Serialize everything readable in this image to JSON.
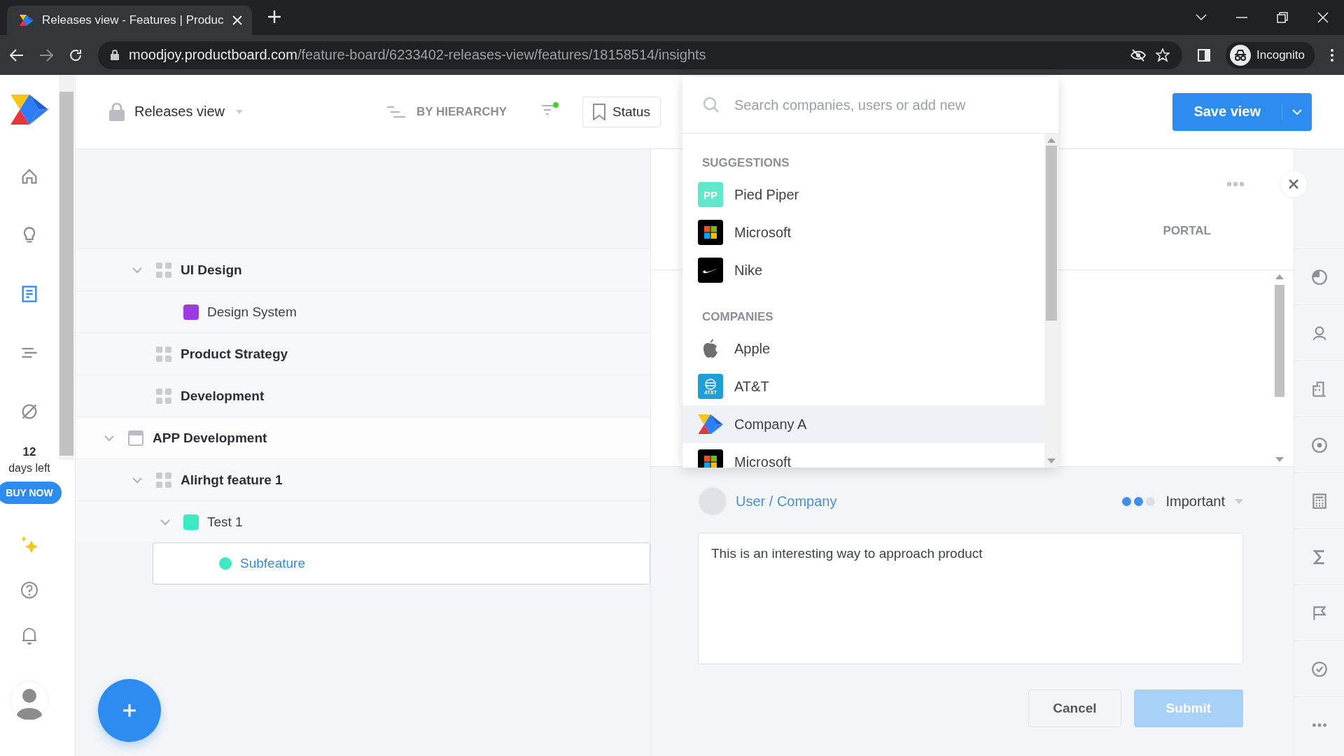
{
  "browser": {
    "tab": {
      "title": "Releases view - Features | Produc"
    },
    "url": {
      "host": "moodjoy.productboard.com",
      "path": "/feature-board/6233402-releases-view/features/18158514/insights"
    },
    "profile": "Incognito"
  },
  "nav": {
    "items": [
      {
        "kind": "home",
        "selected": false
      },
      {
        "kind": "bulb",
        "selected": false
      },
      {
        "kind": "doc",
        "selected": true
      },
      {
        "kind": "lines",
        "selected": false
      },
      {
        "kind": "compass",
        "selected": false
      }
    ],
    "trial": {
      "count": "12",
      "label": "days left",
      "button": "BUY NOW"
    }
  },
  "header": {
    "view_title": "Releases view",
    "grouping": "BY HIERARCHY",
    "filter": {
      "active": true
    },
    "status_button": "Status",
    "save_button": "Save view"
  },
  "tree": {
    "continued": [
      {
        "label": "UI Design",
        "kind": "group",
        "expanded": true,
        "selected": false,
        "children": [
          {
            "label": "Design System",
            "kind": "feature",
            "color": "#9b3be8",
            "selected": false
          }
        ]
      },
      {
        "label": "Product Strategy",
        "kind": "group",
        "selected": false
      },
      {
        "label": "Development",
        "kind": "group",
        "selected": false
      }
    ],
    "items": [
      {
        "label": "APP Development",
        "kind": "release",
        "expanded": true,
        "selected": false,
        "children": [
          {
            "label": "Alirhgt feature 1",
            "kind": "group",
            "expanded": true,
            "selected": false,
            "children": [
              {
                "label": "Test 1",
                "kind": "feature",
                "color": "#3ee8c3",
                "expanded": true,
                "selected": false,
                "children": [
                  {
                    "label": "Subfeature",
                    "kind": "subfeature",
                    "color": "#3ee8c3",
                    "selected": true
                  }
                ]
              }
            ]
          }
        ]
      }
    ]
  },
  "dropdown": {
    "search": {
      "placeholder": "Search companies, users or add new"
    },
    "sections": [
      {
        "title": "SUGGESTIONS",
        "items": [
          {
            "name": "Pied Piper",
            "kind": "initials",
            "logo_text": "PP",
            "highlighted": false
          },
          {
            "name": "Microsoft",
            "kind": "windows",
            "highlighted": false
          },
          {
            "name": "Nike",
            "kind": "swoosh",
            "highlighted": false
          }
        ]
      },
      {
        "title": "COMPANIES",
        "items": [
          {
            "name": "Apple",
            "kind": "apple",
            "highlighted": false
          },
          {
            "name": "AT&T",
            "kind": "globe",
            "logo_text": "AT&T",
            "highlighted": false
          },
          {
            "name": "Company A",
            "kind": "chevron",
            "highlighted": true
          },
          {
            "name": "Microsoft",
            "kind": "windows",
            "highlighted": false
          }
        ]
      }
    ]
  },
  "detail": {
    "tab": "PORTAL",
    "insight": {
      "source": "User / Company",
      "importance": {
        "label": "Important",
        "stars": 2
      },
      "text": "This is an interesting way to approach product"
    },
    "buttons": [
      {
        "label": "Cancel",
        "kind": "secondary",
        "disabled": false
      },
      {
        "label": "Submit",
        "kind": "primary",
        "disabled": true
      }
    ]
  },
  "right_toolbar": {
    "items": [
      {
        "kind": "pie"
      },
      {
        "kind": "user"
      },
      {
        "kind": "building"
      },
      {
        "kind": "target"
      },
      {
        "kind": "calculator"
      },
      {
        "kind": "sigma"
      },
      {
        "kind": "flag"
      },
      {
        "kind": "check"
      },
      {
        "kind": "more"
      }
    ]
  }
}
